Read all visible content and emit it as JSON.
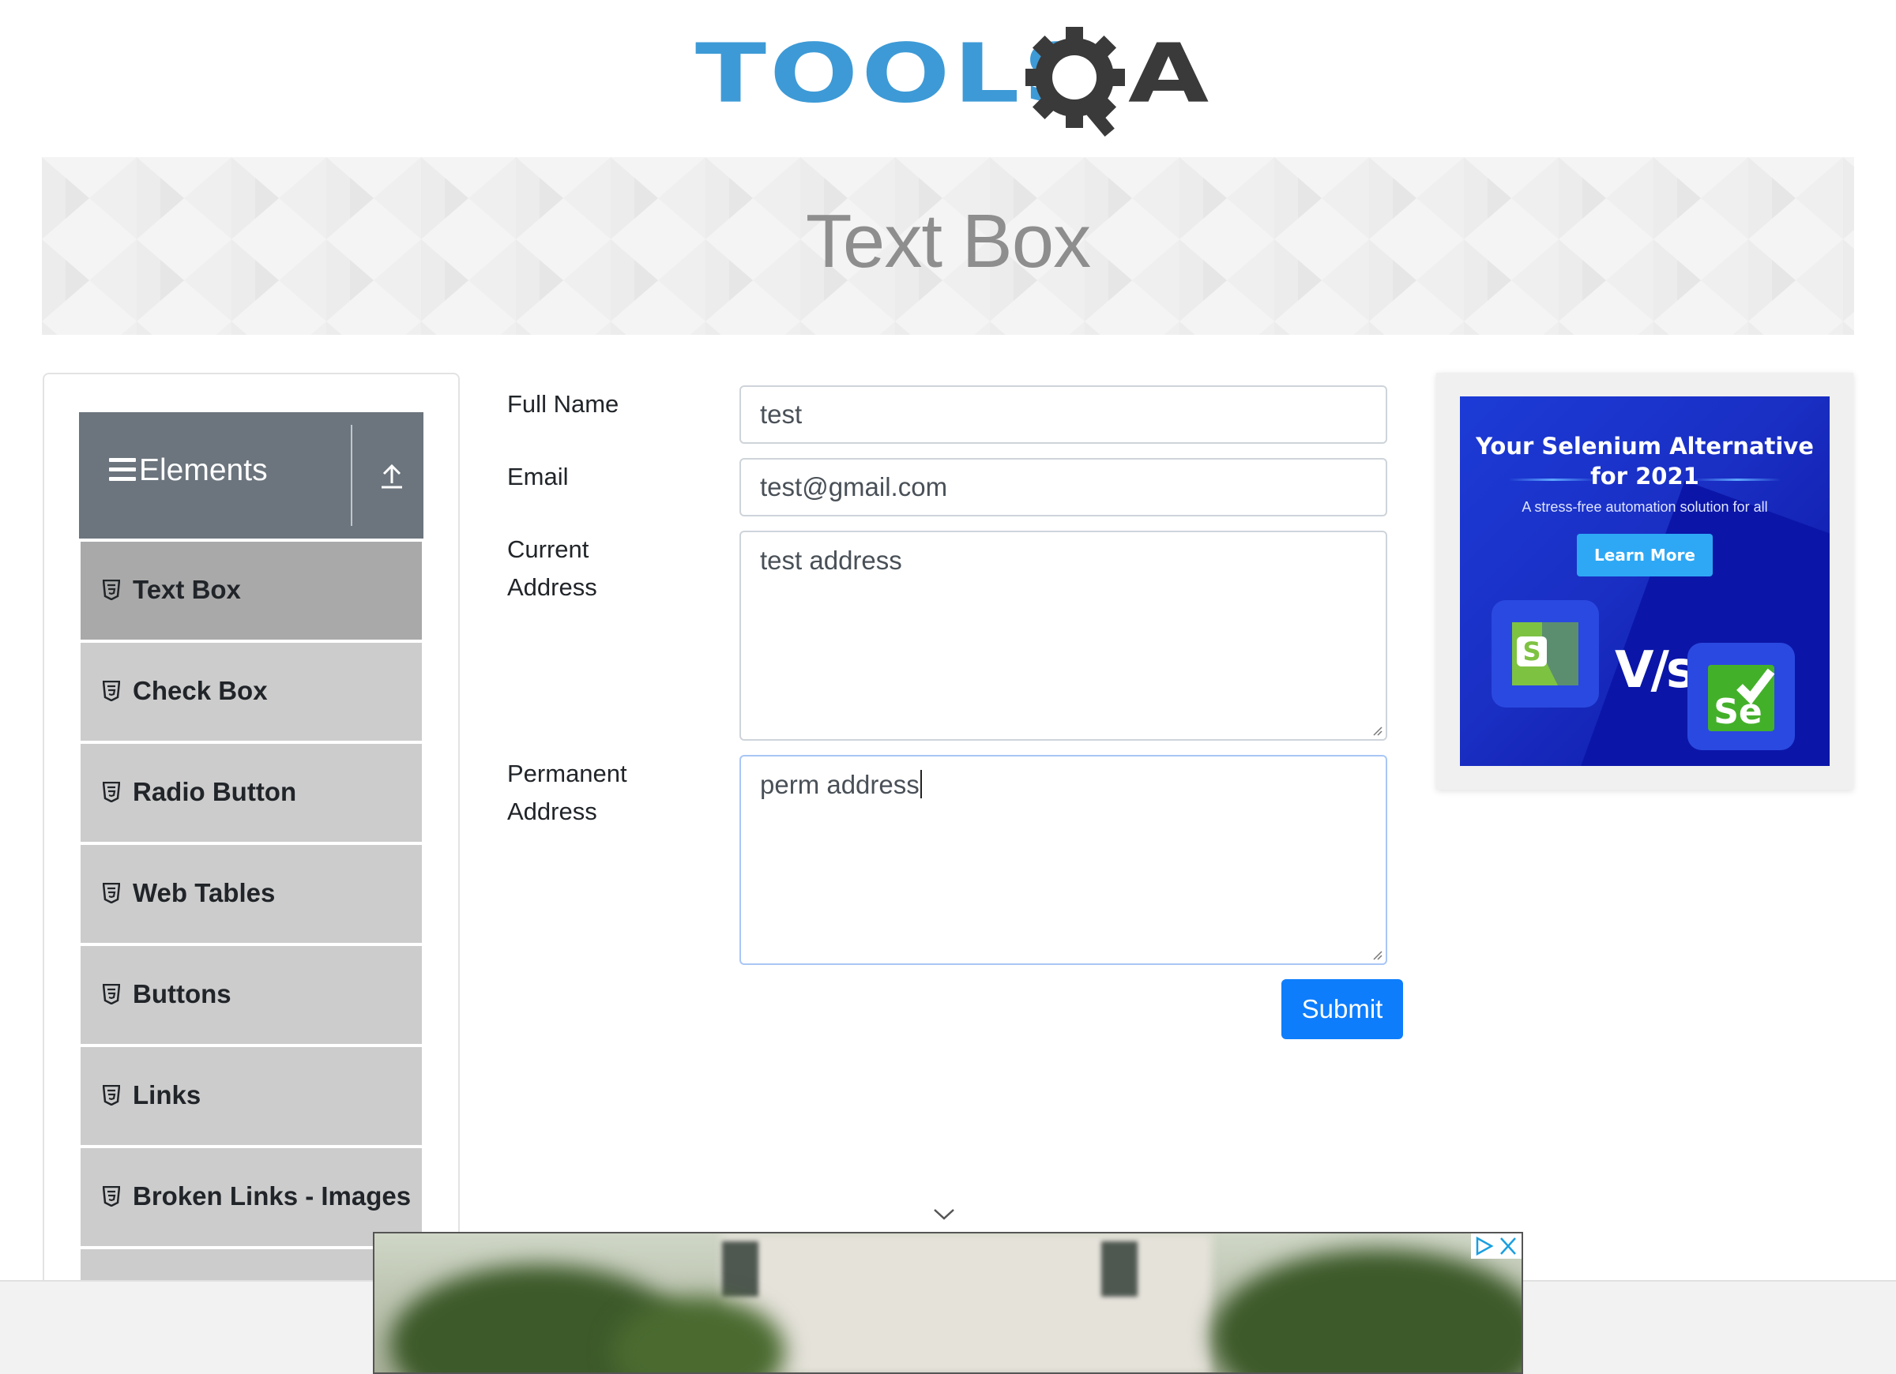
{
  "header": {
    "logo_text_left": "TOOLS",
    "logo_text_right": "A"
  },
  "banner": {
    "title": "Text Box"
  },
  "sidebar": {
    "group_title": "Elements",
    "items": [
      {
        "label": "Text Box",
        "active": true
      },
      {
        "label": "Check Box"
      },
      {
        "label": "Radio Button"
      },
      {
        "label": "Web Tables"
      },
      {
        "label": "Buttons"
      },
      {
        "label": "Links"
      },
      {
        "label": "Broken Links - Images"
      }
    ]
  },
  "form": {
    "full_name": {
      "label": "Full Name",
      "value": "test"
    },
    "email": {
      "label": "Email",
      "value": "test@gmail.com"
    },
    "current_address": {
      "label_line1": "Current",
      "label_line2": "Address",
      "value": "test address"
    },
    "permanent_address": {
      "label_line1": "Permanent",
      "label_line2": "Address",
      "value": "perm address"
    },
    "submit_label": "Submit"
  },
  "side_ad": {
    "headline_line1": "Your Selenium Alternative",
    "headline_line2": "for 2021",
    "subtext": "A stress-free automation solution for all",
    "button_label": "Learn More",
    "vs_text": "V/s",
    "logo_left": "S",
    "logo_right": "Se"
  },
  "colors": {
    "brand_blue": "#3d9ad6",
    "primary_button": "#0d7dfc",
    "sidebar_header": "#6c757d",
    "menu_item": "#cccccc",
    "menu_item_active": "#a9a9a9",
    "ad_blue": "#1c3bd6"
  },
  "icons": {
    "menu": "hamburger-icon",
    "collapse": "upload-arrow-icon",
    "item": "html5-shield-icon",
    "ad_choices": "ad-choices-icon",
    "ad_close": "close-icon",
    "chevron": "chevron-down-icon"
  }
}
